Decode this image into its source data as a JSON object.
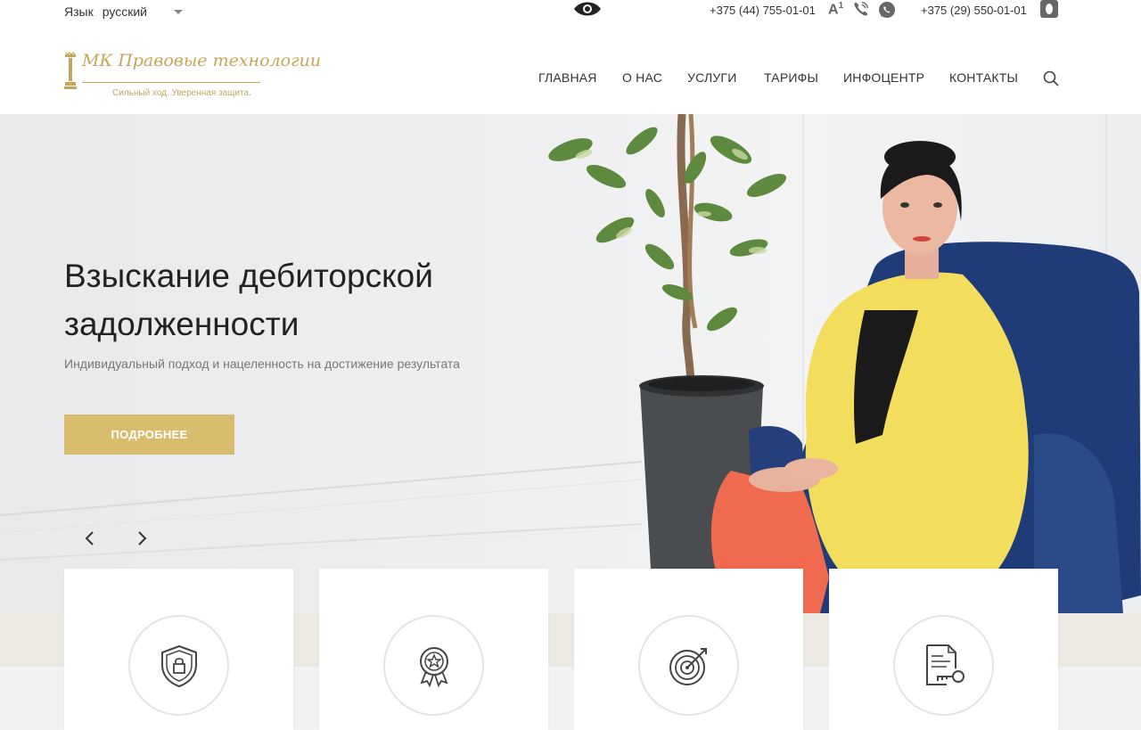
{
  "topbar": {
    "lang_label": "Язык",
    "lang_value": "русский",
    "phone1": "+375 (44) 755-01-01",
    "font_size_label": "A",
    "font_size_sup": "1",
    "phone2": "+375 (29) 550-01-01",
    "icons": [
      "eye-icon",
      "font-size-icon",
      "viber-icon",
      "whatsapp-icon",
      "apple-icon",
      "chevron-down-icon"
    ]
  },
  "logo": {
    "name": "МК Правовые технологии",
    "tagline": "Сильный ход. Уверенная защита."
  },
  "nav": {
    "items": [
      "ГЛАВНАЯ",
      "О НАС",
      "УСЛУГИ",
      "ТАРИФЫ",
      "ИНФОЦЕНТР",
      "КОНТАКТЫ"
    ],
    "search_icon": "search-icon"
  },
  "hero": {
    "title": "Взыскание дебиторской задолженности",
    "subtitle": "Индивидуальный подход и нацеленность на достижение результата",
    "button": "ПОДРОБНЕЕ",
    "prev_icon": "chevron-left-icon",
    "next_icon": "chevron-right-icon"
  },
  "cards": [
    {
      "icon": "shield-lock-icon"
    },
    {
      "icon": "award-badge-icon"
    },
    {
      "icon": "target-icon"
    },
    {
      "icon": "document-key-icon"
    }
  ],
  "colors": {
    "accent": "#d8bd6f",
    "logo_gold": "#c6a65a",
    "text": "#333333"
  }
}
